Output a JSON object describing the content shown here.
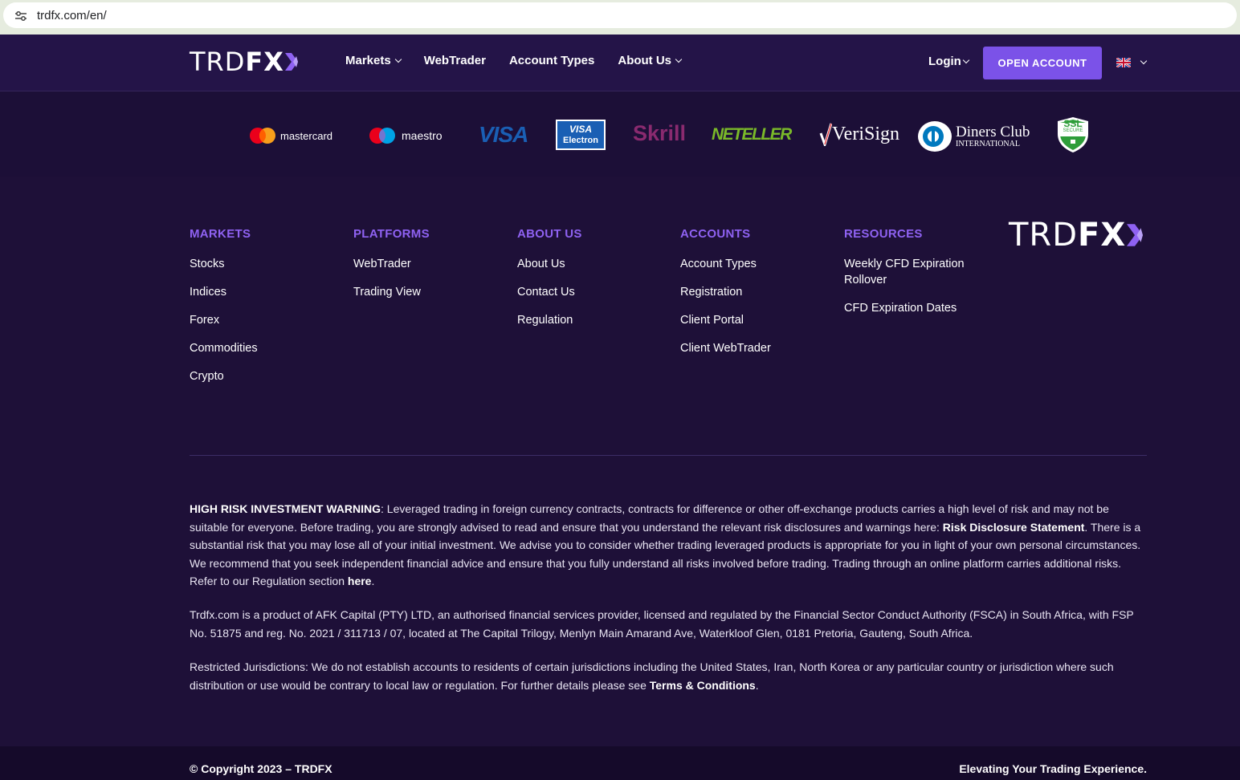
{
  "browser": {
    "url": "trdfx.com/en/"
  },
  "nav": {
    "logo_thin": "TRD",
    "logo_bold": "FX",
    "links": [
      {
        "label": "Markets"
      },
      {
        "label": "WebTrader"
      },
      {
        "label": "Account Types"
      },
      {
        "label": "About Us"
      }
    ],
    "login": "Login",
    "open_account": "OPEN ACCOUNT"
  },
  "payments": {
    "mastercard": "mastercard",
    "maestro": "maestro",
    "visa": "VISA",
    "visa_electron_top": "VISA",
    "visa_electron_bottom": "Electron",
    "skrill": "Skrill",
    "neteller": "NETELLER",
    "verisign": "VeriSign",
    "diners_top": "Diners Club",
    "diners_bottom": "INTERNATIONAL",
    "ssl_top": "SSL",
    "ssl_bottom": "SECURE"
  },
  "footer": {
    "columns": [
      {
        "title": "MARKETS",
        "items": [
          "Stocks",
          "Indices",
          "Forex",
          "Commodities",
          "Crypto"
        ]
      },
      {
        "title": "PLATFORMS",
        "items": [
          "WebTrader",
          "Trading View"
        ]
      },
      {
        "title": "ABOUT US",
        "items": [
          "About Us",
          "Contact Us",
          "Regulation"
        ]
      },
      {
        "title": "ACCOUNTS",
        "items": [
          "Account Types",
          "Registration",
          "Client Portal",
          "Client WebTrader"
        ]
      },
      {
        "title": "RESOURCES",
        "items": [
          "Weekly CFD Expiration Rollover",
          "CFD Expiration Dates"
        ]
      }
    ],
    "logo_thin": "TRD",
    "logo_bold": "FX"
  },
  "legal": {
    "warning_label": "HIGH RISK INVESTMENT WARNING",
    "warning_text": ": Leveraged trading in foreign currency contracts, contracts for difference or other off-exchange products carries a high level of risk and may not be suitable for everyone. Before trading, you are strongly advised to read and ensure that you understand the relevant risk disclosures and warnings here: ",
    "warning_link": "Risk Disclosure Statement",
    "warning_text2": ". There is a substantial risk that you may lose all of your initial investment. We advise you to consider whether trading leveraged products is appropriate for you in light of your own personal circumstances. We recommend that you seek independent financial advice and ensure that you fully understand all risks involved before trading. Trading through an online platform carries additional risks. Refer to our Regulation section ",
    "warning_link2": "here",
    "warning_end": ".",
    "company": "Trdfx.com is a product of AFK Capital (PTY) LTD, an authorised financial services provider, licensed and regulated by the Financial Sector Conduct Authority (FSCA) in South Africa, with FSP No. 51875 and reg. No. 2021 / 311713 / 07, located at The Capital Trilogy, Menlyn Main Amarand Ave, Waterkloof Glen, 0181 Pretoria, Gauteng, South Africa.",
    "restricted": "Restricted Jurisdictions: We do not establish accounts to residents of certain jurisdictions including the United States, Iran, North Korea or any particular country or jurisdiction where such distribution or use would be contrary to local law or regulation. For further details please see ",
    "restricted_link": "Terms & Conditions",
    "restricted_end": "."
  },
  "bottom": {
    "copyright": "© Copyright 2023 – TRDFX",
    "tagline": "Elevating Your Trading Experience."
  },
  "colors": {
    "accent": "#7b52e8",
    "heading": "#8f62f2",
    "background": "#1e1038"
  }
}
